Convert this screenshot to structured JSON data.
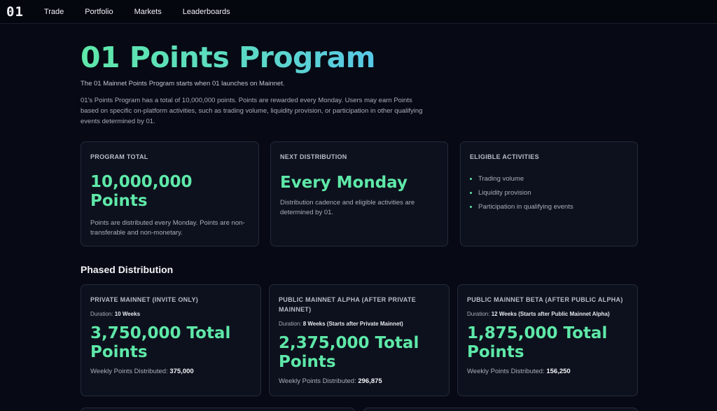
{
  "nav": {
    "logo": "01",
    "links": [
      "Trade",
      "Portfolio",
      "Markets",
      "Leaderboards"
    ]
  },
  "hero": {
    "title": "01 Points Program",
    "lead": "The 01 Mainnet Points Program starts when 01 launches on Mainnet.",
    "description": "01's Points Program has a total of 10,000,000 points. Points are rewarded every Monday. Users may earn Points based on specific on-platform activities, such as trading volume, liquidity provision, or participation in other qualifying events determined by 01."
  },
  "summary": {
    "program_total": {
      "label": "PROGRAM TOTAL",
      "value_line1": "10,000,000",
      "value_line2": "Points",
      "note": "Points are distributed every Monday. Points are non-transferable and non-monetary."
    },
    "next_distribution": {
      "label": "NEXT DISTRIBUTION",
      "value": "Every Monday",
      "note": "Distribution cadence and eligible activities are determined by 01."
    },
    "eligible": {
      "label": "ELIGIBLE ACTIVITIES",
      "items": [
        "Trading volume",
        "Liquidity provision",
        "Participation in qualifying events"
      ]
    }
  },
  "phased": {
    "title": "Phased Distribution",
    "duration_label": "Duration:",
    "weekly_label": "Weekly Points Distributed:",
    "phases": [
      {
        "label": "PRIVATE MAINNET (INVITE ONLY)",
        "duration": "10 Weeks",
        "total_line1": "3,750,000 Total",
        "total_line2": "Points",
        "weekly": "375,000"
      },
      {
        "label": "PUBLIC MAINNET ALPHA (AFTER PRIVATE MAINNET)",
        "duration": "8 Weeks (Starts after Private Mainnet)",
        "total_line1": "2,375,000 Total",
        "total_line2": "Points",
        "weekly": "296,875"
      },
      {
        "label": "PUBLIC MAINNET BETA (AFTER PUBLIC ALPHA)",
        "duration": "12 Weeks (Starts after Public Mainnet Alpha)",
        "total_line1": "1,875,000 Total",
        "total_line2": "Points",
        "weekly": "156,250"
      }
    ]
  }
}
